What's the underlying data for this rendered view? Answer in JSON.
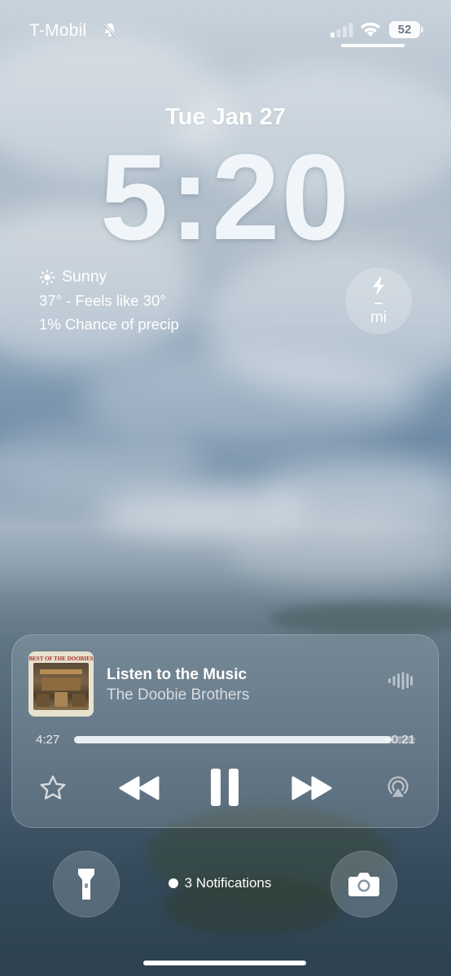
{
  "status_bar": {
    "carrier": "T-Mobil",
    "battery": "52",
    "icons": [
      "bell-slash-icon",
      "signal-icon",
      "wifi-icon",
      "battery-icon"
    ]
  },
  "lock_screen": {
    "date": "Tue Jan 27",
    "time": "5:20"
  },
  "weather": {
    "condition": "Sunny",
    "temperature_line": "37° - Feels like 30°",
    "precip_line": "1% Chance of precip",
    "icon": "sun-icon"
  },
  "distance_widget": {
    "icon": "bolt-icon",
    "value": "–",
    "unit": "mi"
  },
  "now_playing": {
    "album_art_text": "BEST OF THE DOOBIES",
    "title": "Listen to the Music",
    "artist": "The Doobie Brothers",
    "elapsed": "4:27",
    "remaining": "−0:21",
    "progress": 0.93,
    "controls": [
      "star-icon",
      "rewind-icon",
      "pause-icon",
      "fast-forward-icon",
      "airplay-icon"
    ]
  },
  "bottom": {
    "notifications_label": "3 Notifications",
    "left_button_icon": "flashlight-icon",
    "right_button_icon": "camera-icon"
  }
}
